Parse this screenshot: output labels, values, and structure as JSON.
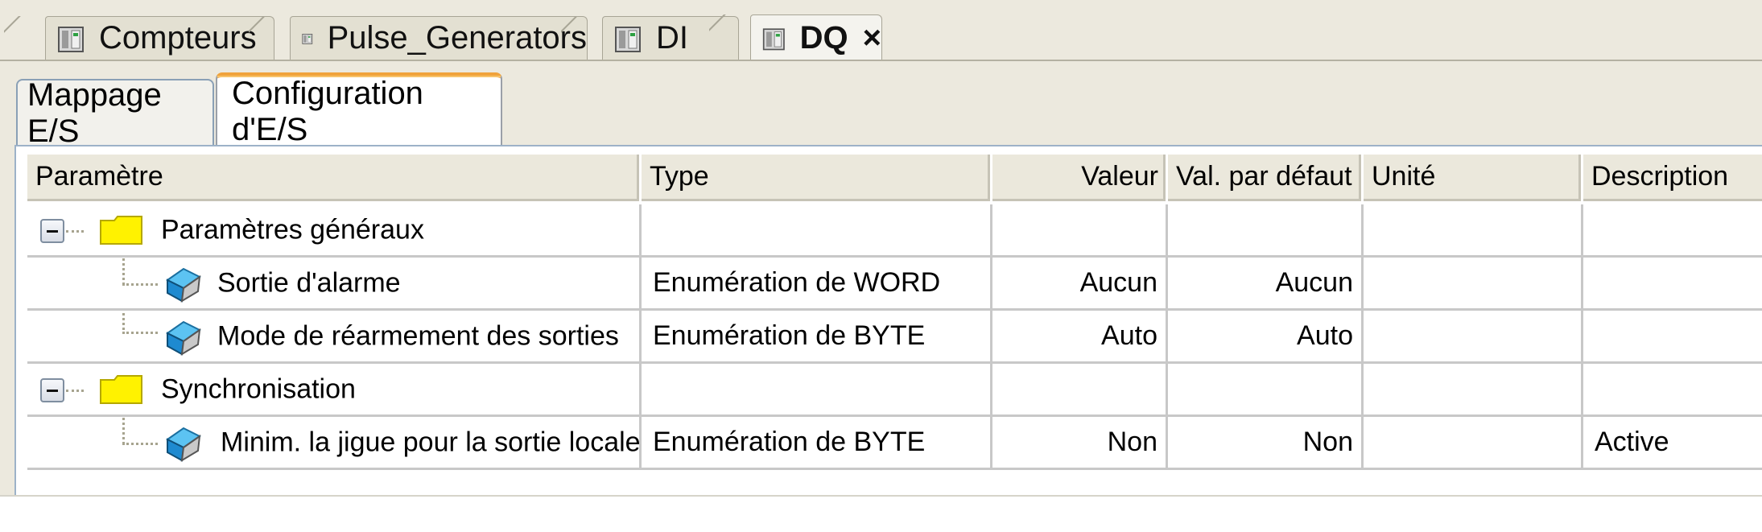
{
  "doc_tabs": [
    {
      "label": "Compteurs",
      "icon": "device-module-icon",
      "active": false
    },
    {
      "label": "Pulse_Generators",
      "icon": "device-module-icon",
      "active": false
    },
    {
      "label": "DI",
      "icon": "device-module-icon",
      "active": false
    },
    {
      "label": "DQ",
      "icon": "device-module-icon",
      "active": true,
      "close": "×"
    }
  ],
  "sub_tabs": [
    {
      "label": "Mappage E/S",
      "active": false
    },
    {
      "label": "Configuration d'E/S",
      "active": true
    }
  ],
  "grid": {
    "columns": [
      "Paramètre",
      "Type",
      "Valeur",
      "Val. par défaut",
      "Unité",
      "Description"
    ],
    "rows": [
      {
        "kind": "group",
        "expanded": true,
        "icon": "folder-icon",
        "parametre": "Paramètres généraux",
        "type": "",
        "valeur": "",
        "defaut": "",
        "unite": "",
        "description": ""
      },
      {
        "kind": "param",
        "icon": "parameter-icon",
        "parametre": "Sortie d'alarme",
        "type": "Enumération de WORD",
        "valeur": "Aucun",
        "defaut": "Aucun",
        "unite": "",
        "description": ""
      },
      {
        "kind": "param",
        "icon": "parameter-icon",
        "parametre": "Mode de réarmement des sorties",
        "type": "Enumération de BYTE",
        "valeur": "Auto",
        "defaut": "Auto",
        "unite": "",
        "description": ""
      },
      {
        "kind": "group",
        "expanded": true,
        "icon": "folder-icon",
        "parametre": "Synchronisation",
        "type": "",
        "valeur": "",
        "defaut": "",
        "unite": "",
        "description": ""
      },
      {
        "kind": "param",
        "icon": "parameter-icon",
        "parametre": "Minim. la jigue pour la sortie locale",
        "type": "Enumération de BYTE",
        "valeur": "Non",
        "defaut": "Non",
        "unite": "",
        "description": "Active"
      }
    ]
  },
  "colors": {
    "accent_tab": "#f0a23b",
    "folder": "#fff200",
    "param_icon": "#2aa0e0",
    "frame": "#ece9de"
  }
}
